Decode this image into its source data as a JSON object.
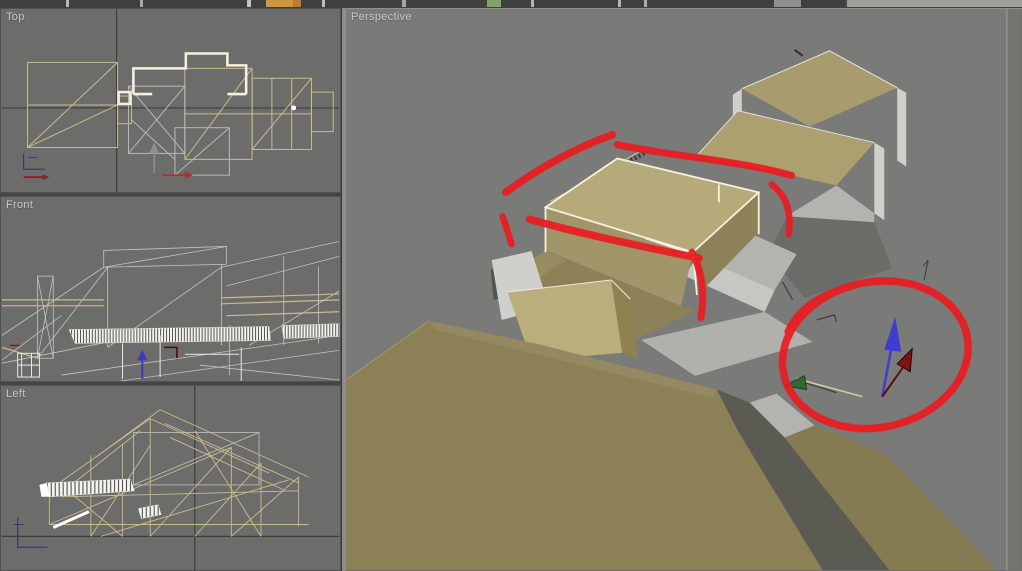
{
  "toolbar": {
    "description_not_text": ""
  },
  "viewports": {
    "top": {
      "label": "Top"
    },
    "front": {
      "label": "Front"
    },
    "left": {
      "label": "Left"
    },
    "perspective": {
      "label": "Perspective"
    }
  },
  "colors": {
    "toolbar_bg": "#3f3f3d",
    "frame": "#454543",
    "ortho_bg": "#6c6c6a",
    "persp_bg": "#7a7a78",
    "divider_light": "#8d8d8b",
    "label_text": "#c9c9c9",
    "wire_tan": "#c9bd8e",
    "wire_gray": "#c3c3c1",
    "wire_dark_axis": "#3e3e3c",
    "selection_white": "#f6f0dd",
    "annotation_red": "#ea1b22",
    "roof_tan": "#a89c6e",
    "roof_tan_light": "#b6aa7a",
    "roof_tan_dark": "#8c8157",
    "wall_light": "#cfcfcb",
    "wall_mid": "#b3b3af",
    "wall_dark": "#636360",
    "gizmo_x": "#7e1410",
    "gizmo_y": "#2e6b33",
    "gizmo_z": "#3d3dcf",
    "gizmo_tan_line": "#d6cda0",
    "toolbar_accent_orange": "#d0953f",
    "toolbar_accent_green": "#8aa06a"
  }
}
